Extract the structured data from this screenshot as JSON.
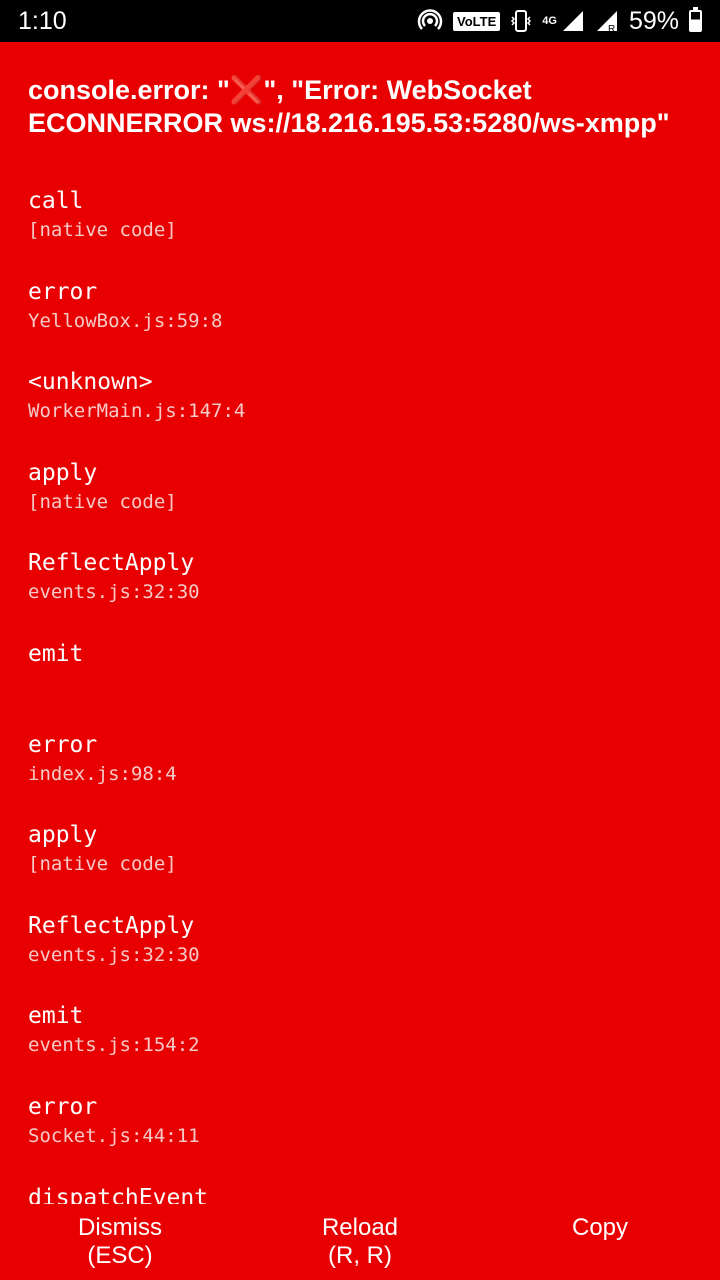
{
  "status_bar": {
    "time": "1:10",
    "volte": "VoLTE",
    "network": "4G",
    "battery": "59%",
    "icons": [
      "hotspot-icon",
      "vibrate-icon",
      "signal-icon",
      "roaming-signal-icon",
      "battery-charging-icon"
    ],
    "battery_level": 0.59
  },
  "error": {
    "title": "console.error: \"❌\", \"Error: WebSocket ECONNERROR ws://18.216.195.53:5280/ws-xmpp\""
  },
  "frames": [
    {
      "method": "call",
      "file": "[native code]"
    },
    {
      "method": "error",
      "file": "YellowBox.js:59:8"
    },
    {
      "method": "<unknown>",
      "file": "WorkerMain.js:147:4"
    },
    {
      "method": "apply",
      "file": "[native code]"
    },
    {
      "method": "ReflectApply",
      "file": "events.js:32:30"
    },
    {
      "method": "emit",
      "file": ""
    },
    {
      "method": "error",
      "file": "index.js:98:4"
    },
    {
      "method": "apply",
      "file": "[native code]"
    },
    {
      "method": "ReflectApply",
      "file": "events.js:32:30"
    },
    {
      "method": "emit",
      "file": "events.js:154:2"
    },
    {
      "method": "error",
      "file": "Socket.js:44:11"
    },
    {
      "method": "dispatchEvent",
      "file": ""
    }
  ],
  "buttons": {
    "dismiss": {
      "line1": "Dismiss",
      "line2": "(ESC)"
    },
    "reload": {
      "line1": "Reload",
      "line2": "(R, R)"
    },
    "copy": {
      "line1": "Copy"
    }
  },
  "colors": {
    "background": "#e80000",
    "status_bar": "#000000",
    "text": "#ffffff",
    "file_text": "#f6c9c9"
  }
}
